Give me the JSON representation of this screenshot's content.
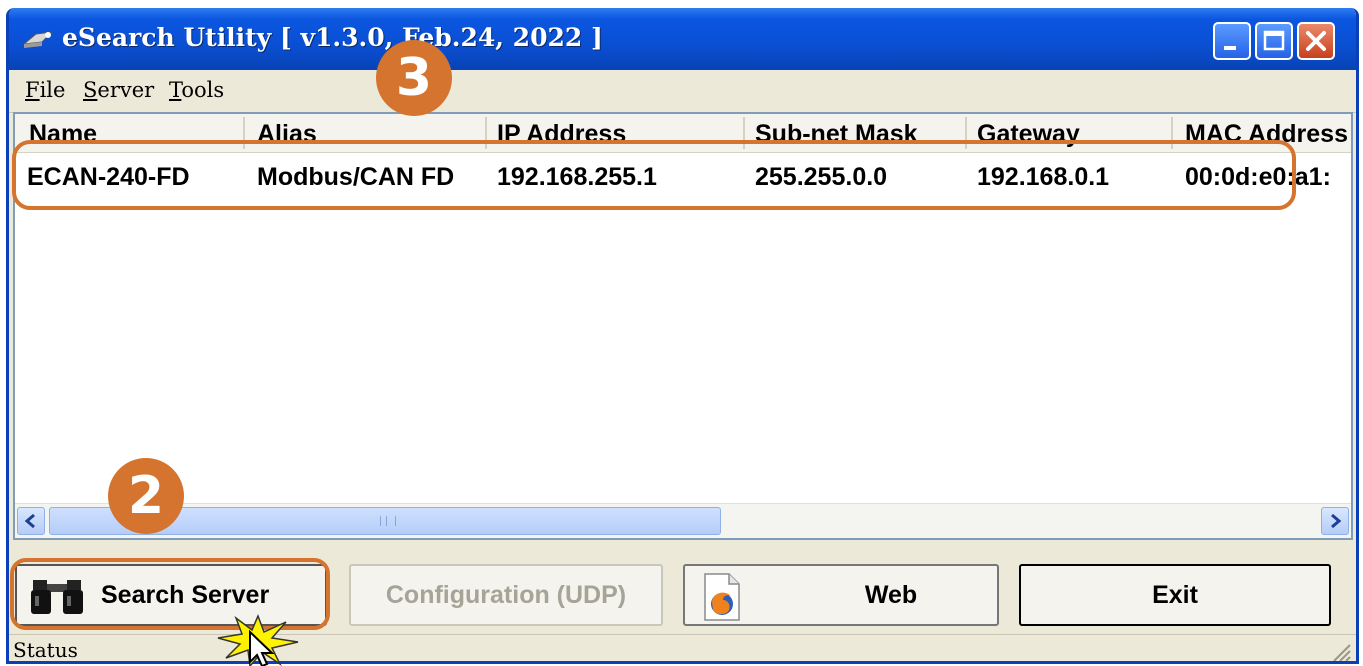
{
  "window": {
    "title": "eSearch Utility [ v1.3.0, Feb.24, 2022 ]"
  },
  "menu": [
    {
      "label": "File",
      "key": "F",
      "rest": "ile"
    },
    {
      "label": "Server",
      "key": "S",
      "rest": "erver"
    },
    {
      "label": "Tools",
      "key": "T",
      "rest": "ools"
    }
  ],
  "table": {
    "columns": [
      "Name",
      "Alias",
      "IP Address",
      "Sub-net Mask",
      "Gateway",
      "MAC Address"
    ],
    "rows": [
      {
        "name": "ECAN-240-FD",
        "alias": "Modbus/CAN FD",
        "ip": "192.168.255.1",
        "mask": "255.255.0.0",
        "gateway": "192.168.0.1",
        "mac": "00:0d:e0:a1:"
      }
    ]
  },
  "buttons": {
    "search": "Search Server",
    "config": "Configuration (UDP)",
    "web": "Web",
    "exit": "Exit"
  },
  "status": "Status",
  "annotations": {
    "step2": "2",
    "step3": "3"
  },
  "colors": {
    "highlight": "#d5742e",
    "titlebar": "#0a4fd3"
  },
  "icons": {
    "title": "network-icon",
    "search": "binoculars-icon",
    "web": "firefox-icon"
  }
}
